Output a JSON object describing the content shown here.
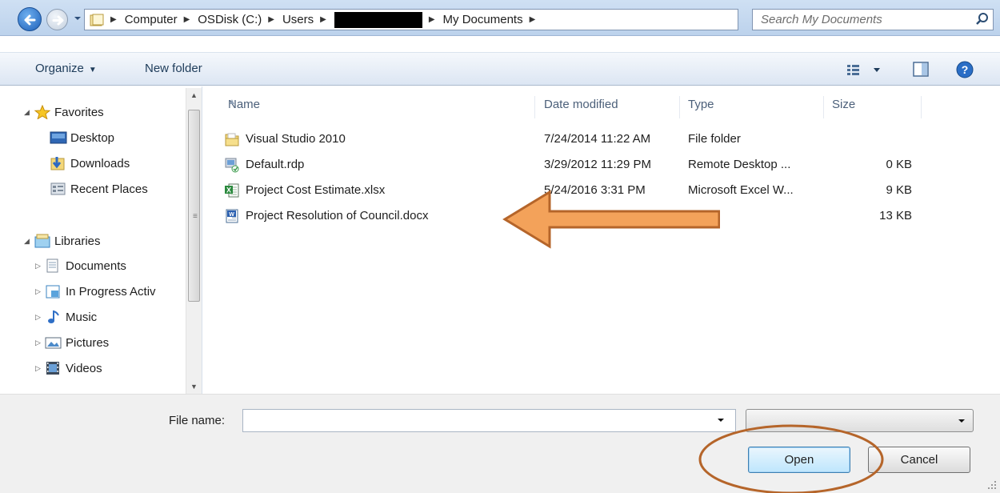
{
  "address_bar": {
    "breadcrumbs": [
      "Computer",
      "OSDisk (C:)",
      "Users",
      "",
      "My Documents"
    ],
    "search_placeholder": "Search My Documents"
  },
  "toolbar": {
    "organize_label": "Organize",
    "new_folder_label": "New folder"
  },
  "nav_pane": {
    "favorites": {
      "label": "Favorites",
      "items": [
        {
          "label": "Desktop",
          "icon": "desktop-icon"
        },
        {
          "label": "Downloads",
          "icon": "downloads-folder-icon"
        },
        {
          "label": "Recent Places",
          "icon": "recent-places-icon"
        }
      ]
    },
    "libraries": {
      "label": "Libraries",
      "items": [
        {
          "label": "Documents",
          "icon": "documents-library-icon"
        },
        {
          "label": "In Progress Activ",
          "icon": "library-icon"
        },
        {
          "label": "Music",
          "icon": "music-icon"
        },
        {
          "label": "Pictures",
          "icon": "pictures-icon"
        },
        {
          "label": "Videos",
          "icon": "videos-icon"
        }
      ]
    }
  },
  "file_list": {
    "columns": [
      "Name",
      "Date modified",
      "Type",
      "Size"
    ],
    "sorted_by": "Name",
    "rows": [
      {
        "name": "Visual Studio 2010",
        "date": "7/24/2014 11:22 AM",
        "type": "File folder",
        "size": "",
        "icon": "folder-icon"
      },
      {
        "name": "Default.rdp",
        "date": "3/29/2012 11:29 PM",
        "type": "Remote Desktop ...",
        "size": "0 KB",
        "icon": "rdp-file-icon"
      },
      {
        "name": "Project Cost Estimate.xlsx",
        "date": "5/24/2016 3:31 PM",
        "type": "Microsoft Excel W...",
        "size": "9 KB",
        "icon": "excel-file-icon"
      },
      {
        "name": "Project Resolution of Council.docx",
        "date": "",
        "type": "",
        "size": "13 KB",
        "icon": "word-file-icon"
      }
    ]
  },
  "file_name": {
    "label": "File name:",
    "value": ""
  },
  "file_type_filter": {
    "value": ""
  },
  "buttons": {
    "open": "Open",
    "cancel": "Cancel"
  },
  "annotations": {
    "arrow_color": "#e07b2a",
    "circle_color": "#b5652a"
  }
}
